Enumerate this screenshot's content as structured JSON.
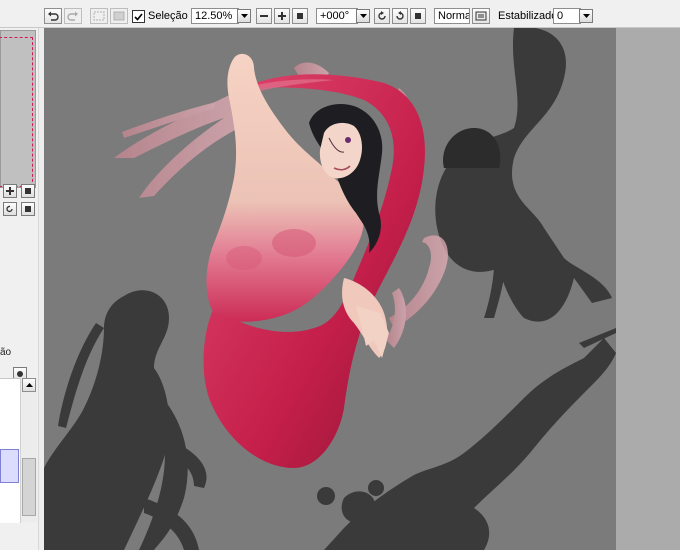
{
  "toolbar": {
    "selection_label": "Seleção",
    "selection_checked": true,
    "zoom_value": "12.50%",
    "rotation_value": "+000°",
    "blend_mode": "Normal",
    "stabilizer_label": "Estabilizador",
    "stabilizer_value": "0"
  },
  "left_panel": {
    "truncated_text": "ão"
  },
  "icons": [
    "undo-icon",
    "redo-icon",
    "deselect-icon",
    "invert-selection-icon",
    "zoom-out-icon",
    "zoom-in-icon",
    "zoom-reset-icon",
    "rotate-ccw-icon",
    "rotate-cw-icon",
    "rotate-reset-icon",
    "flip-icon",
    "dropdown-arrow-icon",
    "scroll-up-icon"
  ],
  "colors": {
    "window_bg": "#f0f0f0",
    "canvas_bg": "#7b7b7b",
    "outside_canvas": "#ababab",
    "navigator_frame": "#d11a4f",
    "mermaid_tail": "#c8204f",
    "silhouette": "#3a3a3a"
  }
}
